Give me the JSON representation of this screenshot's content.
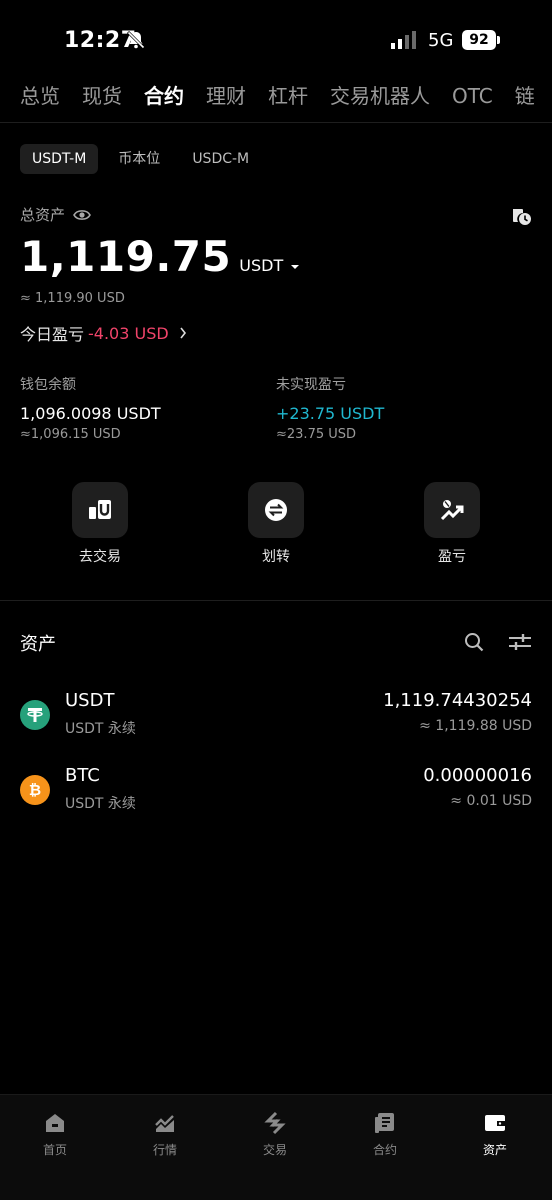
{
  "status_bar": {
    "time": "12:27",
    "network": "5G",
    "battery": "92"
  },
  "top_tabs": [
    {
      "label": "总览"
    },
    {
      "label": "现货"
    },
    {
      "label": "合约"
    },
    {
      "label": "理财"
    },
    {
      "label": "杠杆"
    },
    {
      "label": "交易机器人"
    },
    {
      "label": "OTC"
    },
    {
      "label": "链"
    }
  ],
  "active_top_tab": "合约",
  "sub_tabs": [
    {
      "label": "USDT-M"
    },
    {
      "label": "币本位"
    },
    {
      "label": "USDC-M"
    }
  ],
  "summary": {
    "total_label": "总资产",
    "total_value": "1,119.75",
    "total_unit": "USDT",
    "total_usd": "≈ 1,119.90 USD",
    "today_pnl_label": "今日盈亏",
    "today_pnl_value": "-4.03 USD"
  },
  "wallet": {
    "balance_label": "钱包余额",
    "balance_value": "1,096.0098 USDT",
    "balance_usd": "≈1,096.15 USD",
    "unrealized_label": "未实现盈亏",
    "unrealized_value": "+23.75 USDT",
    "unrealized_usd": "≈23.75 USD"
  },
  "actions": [
    {
      "label": "去交易",
      "icon": "trade-icon"
    },
    {
      "label": "划转",
      "icon": "transfer-icon"
    },
    {
      "label": "盈亏",
      "icon": "pnl-icon"
    }
  ],
  "assets": {
    "title": "资产",
    "items": [
      {
        "name": "USDT",
        "type": "USDT 永续",
        "amount": "1,119.74430254",
        "usd": "≈ 1,119.88 USD",
        "icon": "tether-icon",
        "color": "#26a17b"
      },
      {
        "name": "BTC",
        "type": "USDT 永续",
        "amount": "0.00000016",
        "usd": "≈ 0.01 USD",
        "icon": "bitcoin-icon",
        "color": "#f7931a"
      }
    ]
  },
  "colors": {
    "negative": "#f0446a",
    "positive": "#20b8d0",
    "background": "#000000"
  },
  "bottom_nav": [
    {
      "label": "首页",
      "icon": "home-icon"
    },
    {
      "label": "行情",
      "icon": "market-icon"
    },
    {
      "label": "交易",
      "icon": "trade-nav-icon"
    },
    {
      "label": "合约",
      "icon": "futures-icon"
    },
    {
      "label": "资产",
      "icon": "wallet-icon"
    }
  ]
}
